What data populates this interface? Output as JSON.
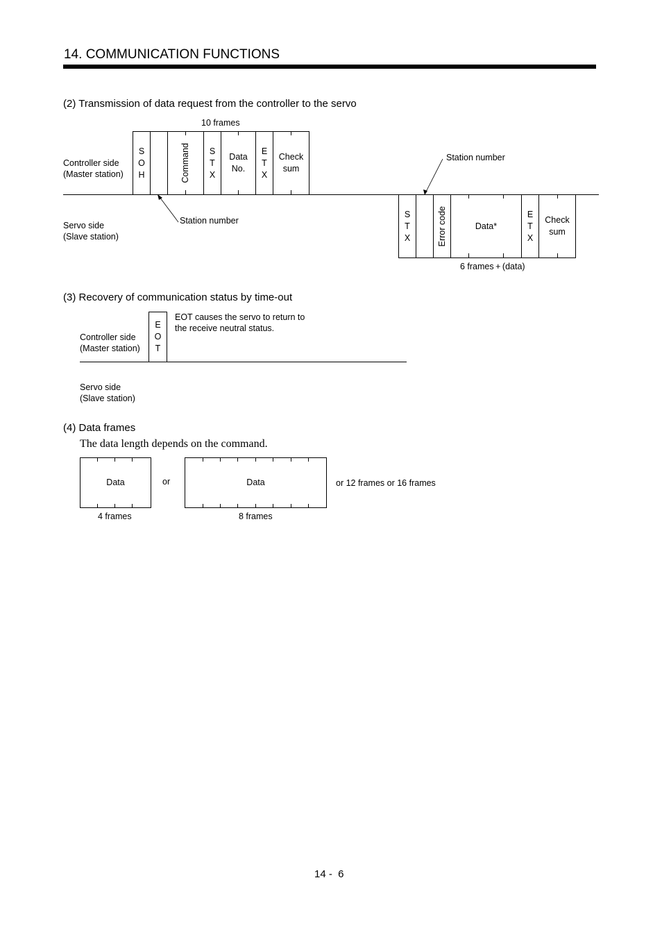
{
  "header": {
    "title": "14. COMMUNICATION FUNCTIONS"
  },
  "section2": {
    "heading": "(2) Transmission of data request from the controller to the servo",
    "frames_label": "10 frames",
    "controller_label": [
      "Controller side",
      "(Master station)"
    ],
    "servo_label": [
      "Servo side",
      "(Slave station)"
    ],
    "controller_cells": [
      {
        "name": "soh",
        "letters": [
          "S",
          "O",
          "H"
        ]
      },
      {
        "name": "station-number",
        "text": ""
      },
      {
        "name": "command",
        "text": "Command",
        "vertical": true
      },
      {
        "name": "stx",
        "letters": [
          "S",
          "T",
          "X"
        ]
      },
      {
        "name": "data-no",
        "lines": [
          "Data",
          "No."
        ]
      },
      {
        "name": "etx",
        "letters": [
          "E",
          "T",
          "X"
        ]
      },
      {
        "name": "check-sum",
        "lines": [
          "Check",
          "sum"
        ]
      }
    ],
    "controller_station_callout": "Station number",
    "servo_station_callout": "Station number",
    "servo_cells": [
      {
        "name": "stx",
        "letters": [
          "S",
          "T",
          "X"
        ]
      },
      {
        "name": "station-number",
        "text": ""
      },
      {
        "name": "error-code",
        "text": "Error code",
        "vertical": true
      },
      {
        "name": "data",
        "text": "Data*"
      },
      {
        "name": "etx",
        "letters": [
          "E",
          "T",
          "X"
        ]
      },
      {
        "name": "check-sum",
        "lines": [
          "Check",
          "sum"
        ]
      }
    ],
    "servo_frames_label": "6 frames + (data)"
  },
  "section3": {
    "heading": "(3) Recovery of communication status by time-out",
    "controller_label": [
      "Controller side",
      "(Master station)"
    ],
    "servo_label": [
      "Servo side",
      "(Slave station)"
    ],
    "eot_letters": [
      "E",
      "O",
      "T"
    ],
    "note": [
      "EOT causes the servo to return to",
      "the receive neutral status."
    ]
  },
  "section4": {
    "heading": "(4) Data frames",
    "description": "The data length depends on the command.",
    "box1": {
      "text": "Data",
      "caption": "4 frames"
    },
    "or_label": "or",
    "box2": {
      "text": "Data",
      "caption": "8 frames"
    },
    "more_label": "or 12 frames or 16 frames"
  },
  "footer": {
    "page_number": "14 -  6"
  }
}
